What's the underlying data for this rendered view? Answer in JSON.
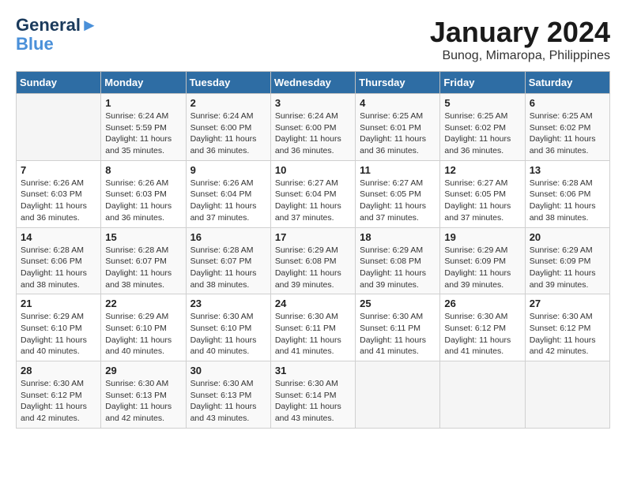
{
  "logo": {
    "line1": "General",
    "line2": "Blue"
  },
  "title": "January 2024",
  "subtitle": "Bunog, Mimaropa, Philippines",
  "days_of_week": [
    "Sunday",
    "Monday",
    "Tuesday",
    "Wednesday",
    "Thursday",
    "Friday",
    "Saturday"
  ],
  "weeks": [
    [
      {
        "day": "",
        "info": ""
      },
      {
        "day": "1",
        "info": "Sunrise: 6:24 AM\nSunset: 5:59 PM\nDaylight: 11 hours\nand 35 minutes."
      },
      {
        "day": "2",
        "info": "Sunrise: 6:24 AM\nSunset: 6:00 PM\nDaylight: 11 hours\nand 36 minutes."
      },
      {
        "day": "3",
        "info": "Sunrise: 6:24 AM\nSunset: 6:00 PM\nDaylight: 11 hours\nand 36 minutes."
      },
      {
        "day": "4",
        "info": "Sunrise: 6:25 AM\nSunset: 6:01 PM\nDaylight: 11 hours\nand 36 minutes."
      },
      {
        "day": "5",
        "info": "Sunrise: 6:25 AM\nSunset: 6:02 PM\nDaylight: 11 hours\nand 36 minutes."
      },
      {
        "day": "6",
        "info": "Sunrise: 6:25 AM\nSunset: 6:02 PM\nDaylight: 11 hours\nand 36 minutes."
      }
    ],
    [
      {
        "day": "7",
        "info": "Sunrise: 6:26 AM\nSunset: 6:03 PM\nDaylight: 11 hours\nand 36 minutes."
      },
      {
        "day": "8",
        "info": "Sunrise: 6:26 AM\nSunset: 6:03 PM\nDaylight: 11 hours\nand 36 minutes."
      },
      {
        "day": "9",
        "info": "Sunrise: 6:26 AM\nSunset: 6:04 PM\nDaylight: 11 hours\nand 37 minutes."
      },
      {
        "day": "10",
        "info": "Sunrise: 6:27 AM\nSunset: 6:04 PM\nDaylight: 11 hours\nand 37 minutes."
      },
      {
        "day": "11",
        "info": "Sunrise: 6:27 AM\nSunset: 6:05 PM\nDaylight: 11 hours\nand 37 minutes."
      },
      {
        "day": "12",
        "info": "Sunrise: 6:27 AM\nSunset: 6:05 PM\nDaylight: 11 hours\nand 37 minutes."
      },
      {
        "day": "13",
        "info": "Sunrise: 6:28 AM\nSunset: 6:06 PM\nDaylight: 11 hours\nand 38 minutes."
      }
    ],
    [
      {
        "day": "14",
        "info": "Sunrise: 6:28 AM\nSunset: 6:06 PM\nDaylight: 11 hours\nand 38 minutes."
      },
      {
        "day": "15",
        "info": "Sunrise: 6:28 AM\nSunset: 6:07 PM\nDaylight: 11 hours\nand 38 minutes."
      },
      {
        "day": "16",
        "info": "Sunrise: 6:28 AM\nSunset: 6:07 PM\nDaylight: 11 hours\nand 38 minutes."
      },
      {
        "day": "17",
        "info": "Sunrise: 6:29 AM\nSunset: 6:08 PM\nDaylight: 11 hours\nand 39 minutes."
      },
      {
        "day": "18",
        "info": "Sunrise: 6:29 AM\nSunset: 6:08 PM\nDaylight: 11 hours\nand 39 minutes."
      },
      {
        "day": "19",
        "info": "Sunrise: 6:29 AM\nSunset: 6:09 PM\nDaylight: 11 hours\nand 39 minutes."
      },
      {
        "day": "20",
        "info": "Sunrise: 6:29 AM\nSunset: 6:09 PM\nDaylight: 11 hours\nand 39 minutes."
      }
    ],
    [
      {
        "day": "21",
        "info": "Sunrise: 6:29 AM\nSunset: 6:10 PM\nDaylight: 11 hours\nand 40 minutes."
      },
      {
        "day": "22",
        "info": "Sunrise: 6:29 AM\nSunset: 6:10 PM\nDaylight: 11 hours\nand 40 minutes."
      },
      {
        "day": "23",
        "info": "Sunrise: 6:30 AM\nSunset: 6:10 PM\nDaylight: 11 hours\nand 40 minutes."
      },
      {
        "day": "24",
        "info": "Sunrise: 6:30 AM\nSunset: 6:11 PM\nDaylight: 11 hours\nand 41 minutes."
      },
      {
        "day": "25",
        "info": "Sunrise: 6:30 AM\nSunset: 6:11 PM\nDaylight: 11 hours\nand 41 minutes."
      },
      {
        "day": "26",
        "info": "Sunrise: 6:30 AM\nSunset: 6:12 PM\nDaylight: 11 hours\nand 41 minutes."
      },
      {
        "day": "27",
        "info": "Sunrise: 6:30 AM\nSunset: 6:12 PM\nDaylight: 11 hours\nand 42 minutes."
      }
    ],
    [
      {
        "day": "28",
        "info": "Sunrise: 6:30 AM\nSunset: 6:12 PM\nDaylight: 11 hours\nand 42 minutes."
      },
      {
        "day": "29",
        "info": "Sunrise: 6:30 AM\nSunset: 6:13 PM\nDaylight: 11 hours\nand 42 minutes."
      },
      {
        "day": "30",
        "info": "Sunrise: 6:30 AM\nSunset: 6:13 PM\nDaylight: 11 hours\nand 43 minutes."
      },
      {
        "day": "31",
        "info": "Sunrise: 6:30 AM\nSunset: 6:14 PM\nDaylight: 11 hours\nand 43 minutes."
      },
      {
        "day": "",
        "info": ""
      },
      {
        "day": "",
        "info": ""
      },
      {
        "day": "",
        "info": ""
      }
    ]
  ]
}
